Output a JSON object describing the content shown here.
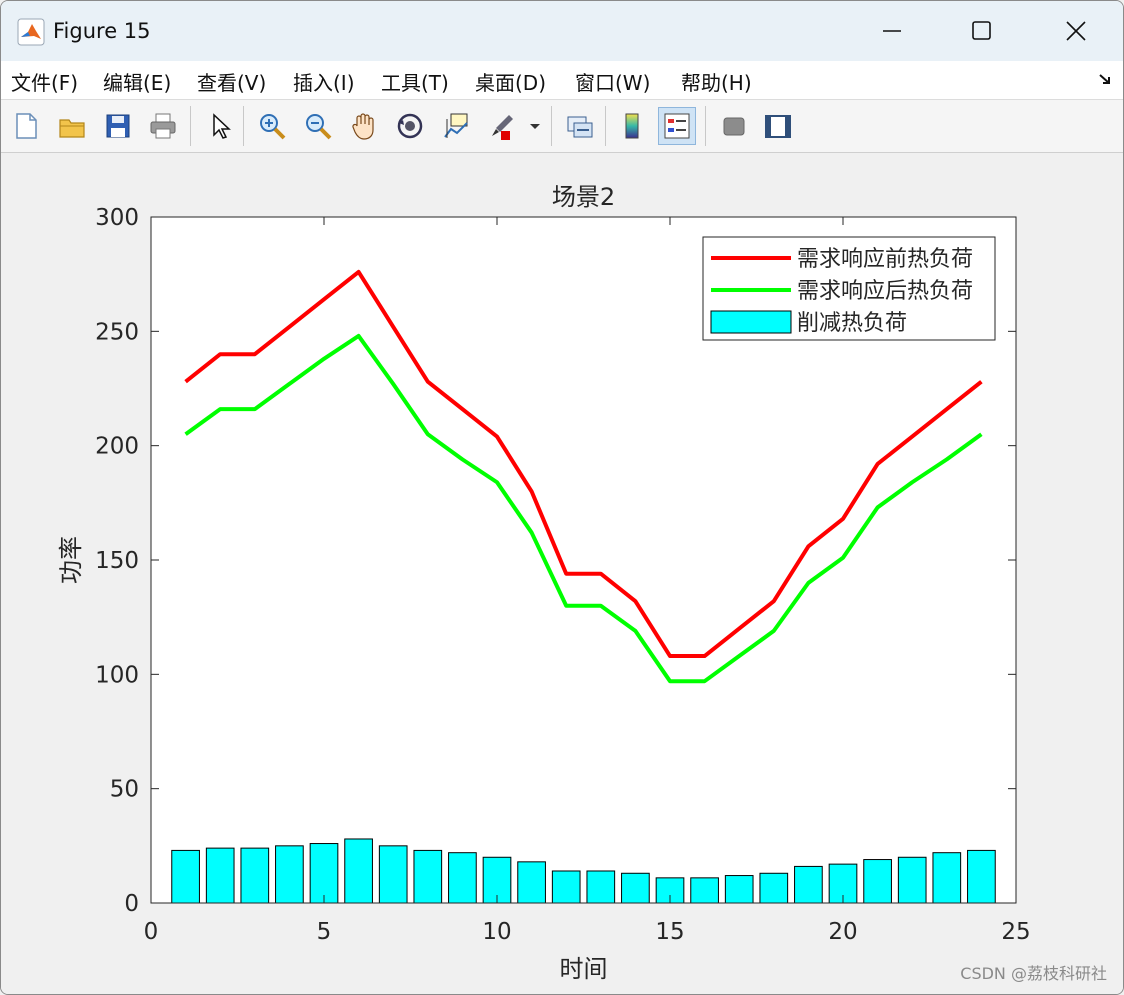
{
  "window": {
    "title": "Figure 15"
  },
  "menu": [
    {
      "label": "文件(F)"
    },
    {
      "label": "编辑(E)"
    },
    {
      "label": "查看(V)"
    },
    {
      "label": "插入(I)"
    },
    {
      "label": "工具(T)"
    },
    {
      "label": "桌面(D)"
    },
    {
      "label": "窗口(W)"
    },
    {
      "label": "帮助(H)"
    }
  ],
  "toolbar": {
    "icons": [
      "new-figure-icon",
      "open-icon",
      "save-icon",
      "print-icon",
      "pointer-icon",
      "zoom-in-icon",
      "zoom-out-icon",
      "pan-icon",
      "rotate-3d-icon",
      "data-cursor-icon",
      "brush-icon",
      "link-icon",
      "colorbar-icon",
      "legend-icon",
      "hide-plot-tools-icon",
      "show-plot-tools-icon"
    ]
  },
  "watermark": "CSDN @荔枝科研社",
  "colors": {
    "before": "#ff0000",
    "after": "#00ff00",
    "bar": "#00ffff"
  },
  "chart_data": {
    "type": "bar",
    "title": "场景2",
    "xlabel": "时间",
    "ylabel": "功率",
    "xlim": [
      0,
      25
    ],
    "ylim": [
      0,
      300
    ],
    "xticks": [
      0,
      5,
      10,
      15,
      20,
      25
    ],
    "yticks": [
      0,
      50,
      100,
      150,
      200,
      250,
      300
    ],
    "x": [
      1,
      2,
      3,
      4,
      5,
      6,
      7,
      8,
      9,
      10,
      11,
      12,
      13,
      14,
      15,
      16,
      17,
      18,
      19,
      20,
      21,
      22,
      23,
      24
    ],
    "legend_position": "top-right",
    "series": [
      {
        "name": "需求响应前热负荷",
        "type": "line",
        "color": "#ff0000",
        "values": [
          228,
          240,
          240,
          252,
          264,
          276,
          252,
          228,
          216,
          204,
          180,
          144,
          144,
          132,
          108,
          108,
          120,
          132,
          156,
          168,
          192,
          204,
          216,
          228
        ]
      },
      {
        "name": "需求响应后热负荷",
        "type": "line",
        "color": "#00ff00",
        "values": [
          205,
          216,
          216,
          227,
          238,
          248,
          227,
          205,
          194,
          184,
          162,
          130,
          130,
          119,
          97,
          97,
          108,
          119,
          140,
          151,
          173,
          184,
          194,
          205
        ]
      },
      {
        "name": "削减热负荷",
        "type": "bar",
        "color": "#00ffff",
        "values": [
          23,
          24,
          24,
          25,
          26,
          28,
          25,
          23,
          22,
          20,
          18,
          14,
          14,
          13,
          11,
          11,
          12,
          13,
          16,
          17,
          19,
          20,
          22,
          23
        ]
      }
    ]
  }
}
